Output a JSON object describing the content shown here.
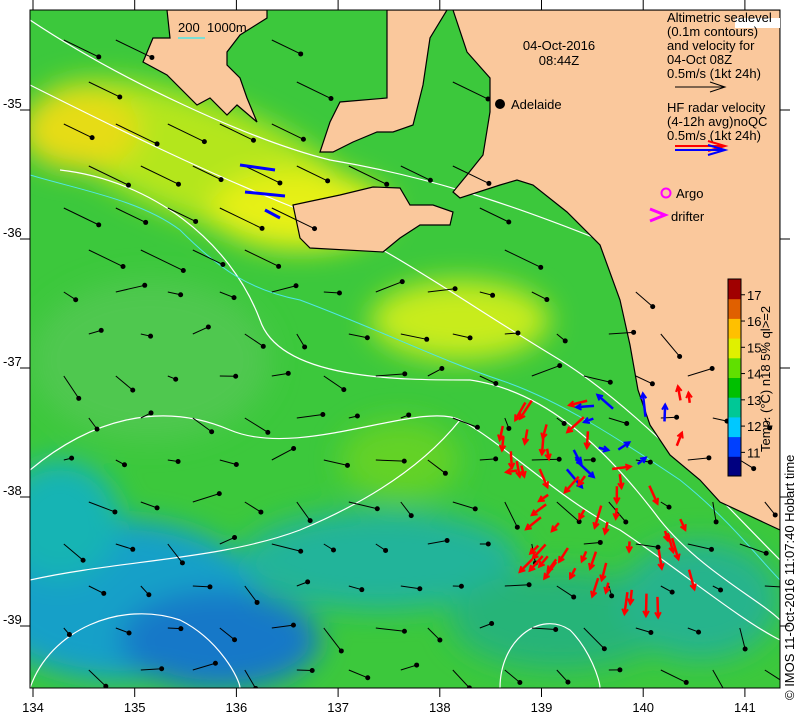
{
  "map": {
    "date": "04-Oct-2016",
    "time": "08:44Z",
    "place_label": "Adelaide",
    "scale_bar": {
      "left": "200",
      "right": "1000m"
    },
    "x_ticks": [
      "134",
      "135",
      "136",
      "137",
      "138",
      "139",
      "140",
      "141"
    ],
    "y_ticks": [
      "-35",
      "-36",
      "-37",
      "-38",
      "-39"
    ],
    "lon_range": [
      134,
      141.3
    ],
    "lat_range": [
      -39.5,
      -34.2
    ]
  },
  "legend": {
    "altimetry_lines": [
      "Altimetric sealevel",
      "(0.1m contours)",
      "and velocity for",
      "04-Oct 08Z",
      "0.5m/s (1kt 24h)"
    ],
    "hf_lines": [
      "HF radar velocity",
      "(4-12h avg)noQC",
      "0.5m/s (1kt 24h)"
    ],
    "argo": "Argo",
    "drifter": "drifter"
  },
  "colorbar": {
    "title": "Temp. (°C) n18 5% ql>=2",
    "ticks": [
      "17",
      "16",
      "15",
      "14",
      "13",
      "12",
      "11"
    ],
    "range": [
      10.1,
      17.6
    ],
    "colors": [
      "#000080",
      "#0040ff",
      "#00c8ff",
      "#00c896",
      "#00c000",
      "#60e000",
      "#e0f000",
      "#ffc000",
      "#e06000",
      "#a00000"
    ]
  },
  "credit": "© IMOS 11-Oct-2016 11:07:40 Hobart time",
  "colors": {
    "land": "#fac89c",
    "ocean": "#3cc83c",
    "hf_red": "#ff0000",
    "hf_blue": "#0000ff",
    "argo": "#ff00ff"
  }
}
